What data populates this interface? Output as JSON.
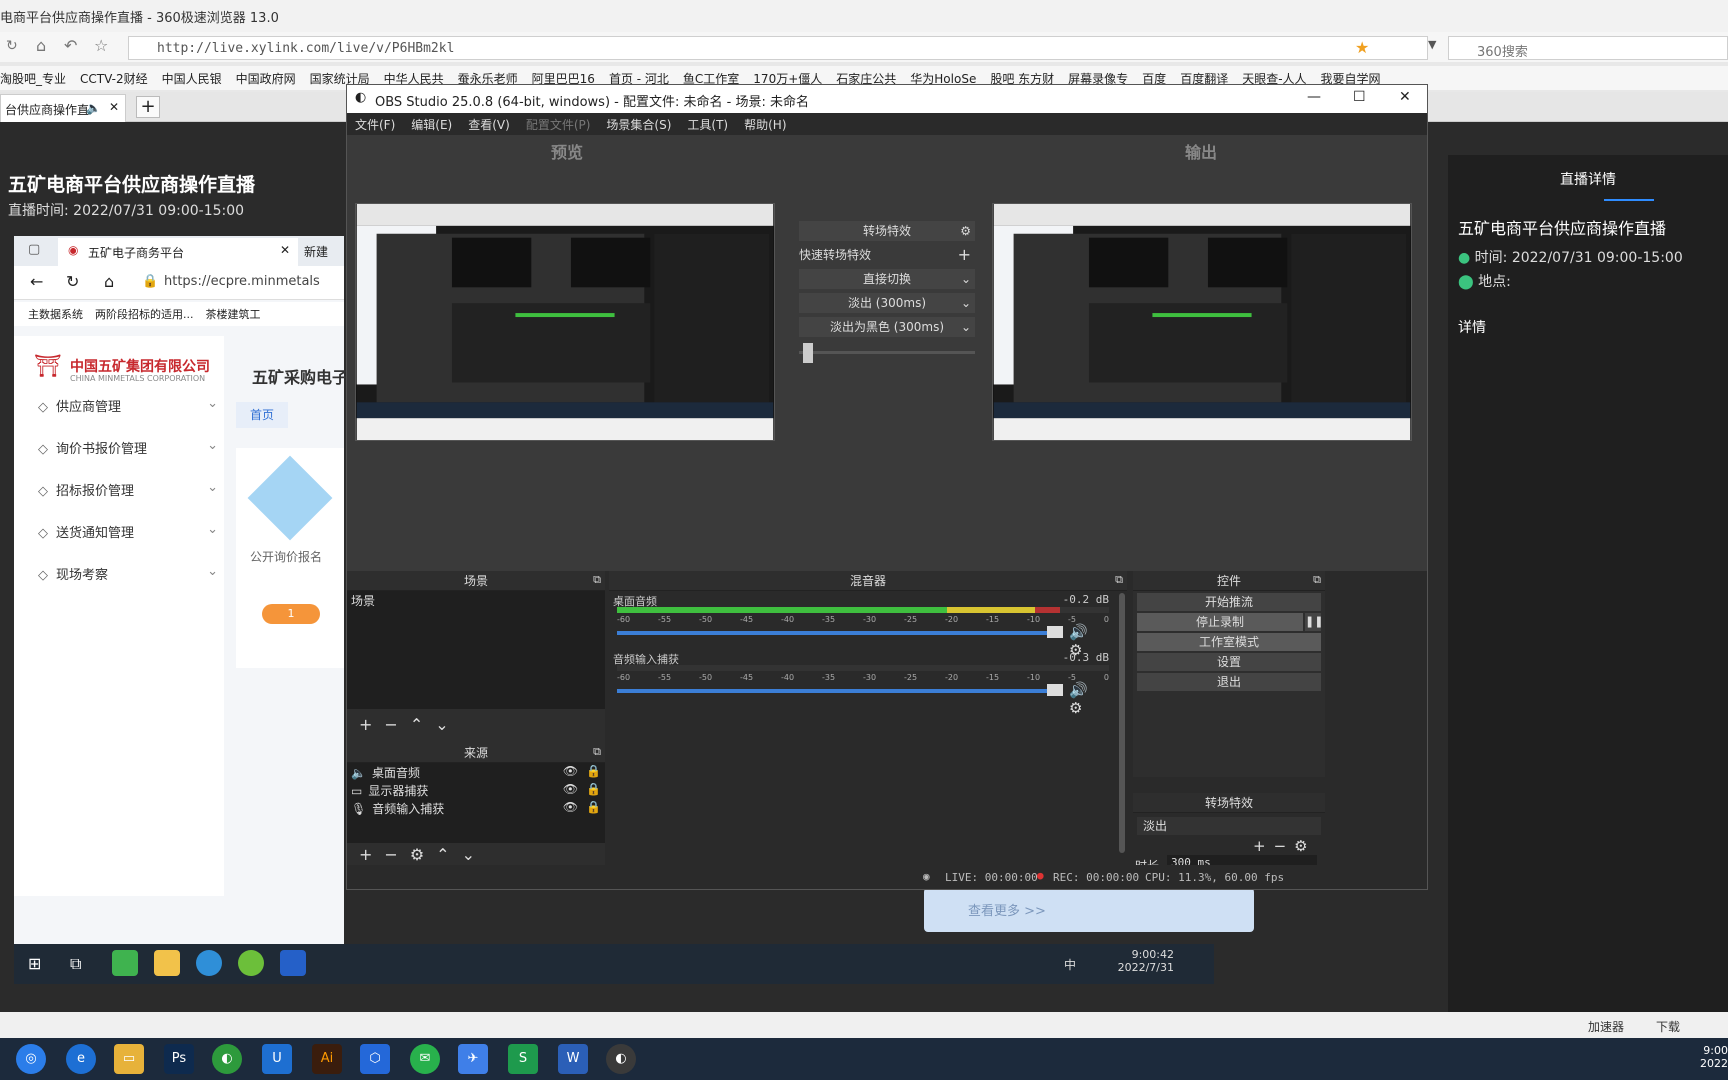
{
  "browser": {
    "window_title": "电商平台供应商操作直播 - 360极速浏览器 13.0",
    "url": "http://live.xylink.com/live/v/P6HBm2kl",
    "search_placeholder": "360搜索",
    "bookmarks": [
      "淘股吧_专业",
      "CCTV-2财经",
      "中国人民银",
      "中国政府网",
      "国家统计局",
      "中华人民共",
      "蚕永乐老师",
      "阿里巴巴16",
      "首页 - 河北",
      "鱼C工作室",
      "170万+僵人",
      "石家庄公共",
      "华为HoloSe",
      "股吧 东方财",
      "屏幕录像专",
      "百度",
      "百度翻译",
      "天眼查-人人",
      "我要自学网"
    ],
    "tab_label": "台供应商操作直",
    "new_tab": "+"
  },
  "page": {
    "title": "五矿电商平台供应商操作直播",
    "time_line": "直播时间: 2022/07/31 09:00-15:00"
  },
  "right_panel": {
    "tab": "直播详情",
    "title": "五矿电商平台供应商操作直播",
    "time": "时间: 2022/07/31 09:00-15:00",
    "place": "地点:",
    "detail": "详情"
  },
  "inner": {
    "tab": "五矿电子商务平台",
    "tab2": "新建",
    "url": "https://ecpre.minmetals",
    "bookmarks": [
      "主数据系统",
      "两阶段招标的适用...",
      "茶楼建筑工"
    ],
    "logo": "中国五矿集团有限公司",
    "logo_en": "CHINA MINMETALS CORPORATION",
    "main_title": "五矿采购电子",
    "home": "首页",
    "menu": [
      "供应商管理",
      "询价书报价管理",
      "招标报价管理",
      "送货通知管理",
      "现场考察"
    ],
    "card_label": "公开询价报名",
    "card_badge": "1",
    "more_button": "查看更多 >>",
    "clock_time": "9:00:42",
    "clock_date": "2022/7/31",
    "ime": "中"
  },
  "obs": {
    "title": "OBS Studio 25.0.8 (64-bit, windows) - 配置文件: 未命名 - 场景: 未命名",
    "menu": [
      "文件(F)",
      "编辑(E)",
      "查看(V)",
      "配置文件(P)",
      "场景集合(S)",
      "工具(T)",
      "帮助(H)"
    ],
    "preview_label": "预览",
    "output_label": "输出",
    "transition_effect": "转场特效",
    "quick_transition": "快速转场特效",
    "direct_cut": "直接切换",
    "fade": "淡出 (300ms)",
    "fade_black": "淡出为黑色 (300ms)",
    "scenes_title": "场景",
    "scene_items": [
      "场景"
    ],
    "sources_title": "来源",
    "sources": [
      "桌面音频",
      "显示器捕获",
      "音频输入捕获"
    ],
    "mixer_title": "混音器",
    "mixer_channels": [
      {
        "name": "桌面音频",
        "db": "-0.2 dB",
        "level": 0.9
      },
      {
        "name": "音频输入捕获",
        "db": "-0.3 dB",
        "level": 0.0
      }
    ],
    "ticks": [
      "-60",
      "-55",
      "-50",
      "-45",
      "-40",
      "-35",
      "-30",
      "-25",
      "-20",
      "-15",
      "-10",
      "-5",
      "0"
    ],
    "controls_title": "控件",
    "controls": [
      "开始推流",
      "停止录制",
      "工作室模式",
      "设置",
      "退出"
    ],
    "transitions_title": "转场特效",
    "transition_select": "淡出",
    "duration_label": "时长",
    "duration_value": "300 ms",
    "status_live": "LIVE: 00:00:00",
    "status_rec": "REC: 00:00:00",
    "status_cpu": "CPU: 11.3%, 60.00 fps"
  },
  "bottom_bar": {
    "accelerator": "加速器",
    "download": "下载"
  },
  "os_clock": {
    "time": "9:00",
    "date": "2022"
  }
}
